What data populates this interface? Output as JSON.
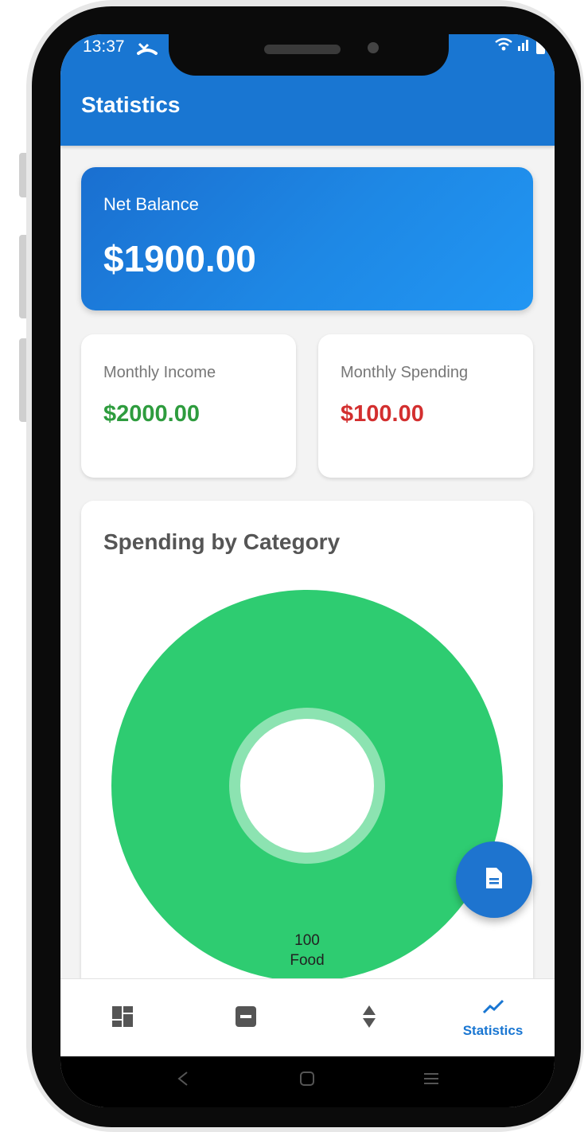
{
  "status_bar": {
    "time": "13:37",
    "left_icon": "missed-call-icon",
    "right_icons": [
      "wifi-icon",
      "signal-icon",
      "battery-icon"
    ]
  },
  "app_bar": {
    "title": "Statistics"
  },
  "balance_card": {
    "label": "Net Balance",
    "value": "$1900.00"
  },
  "income_card": {
    "label": "Monthly Income",
    "value": "$2000.00",
    "color": "#2e9c3e"
  },
  "spending_card": {
    "label": "Monthly Spending",
    "value": "$100.00",
    "color": "#d32f2f"
  },
  "chart_card": {
    "title": "Spending by Category"
  },
  "chart_data": {
    "type": "pie",
    "title": "Spending by Category",
    "categories": [
      "Food"
    ],
    "values": [
      100
    ],
    "colors": [
      "#2ecc71"
    ],
    "slice_labels": [
      {
        "value": "100",
        "category": "Food"
      }
    ],
    "donut": true
  },
  "fab": {
    "icon": "document-icon"
  },
  "bottom_nav": {
    "items": [
      {
        "icon": "dashboard-icon",
        "label": ""
      },
      {
        "icon": "minus-box-icon",
        "label": ""
      },
      {
        "icon": "sort-icon",
        "label": ""
      },
      {
        "icon": "trending-up-icon",
        "label": "Statistics",
        "active": true
      }
    ],
    "active_color": "#1976d2",
    "inactive_color": "#555555"
  },
  "system_nav": {
    "icons": [
      "back-icon",
      "home-icon",
      "recents-icon"
    ]
  },
  "colors": {
    "primary": "#1976d2",
    "chart_green": "#2ecc71",
    "income_green": "#2e9c3e",
    "spending_red": "#d32f2f"
  }
}
